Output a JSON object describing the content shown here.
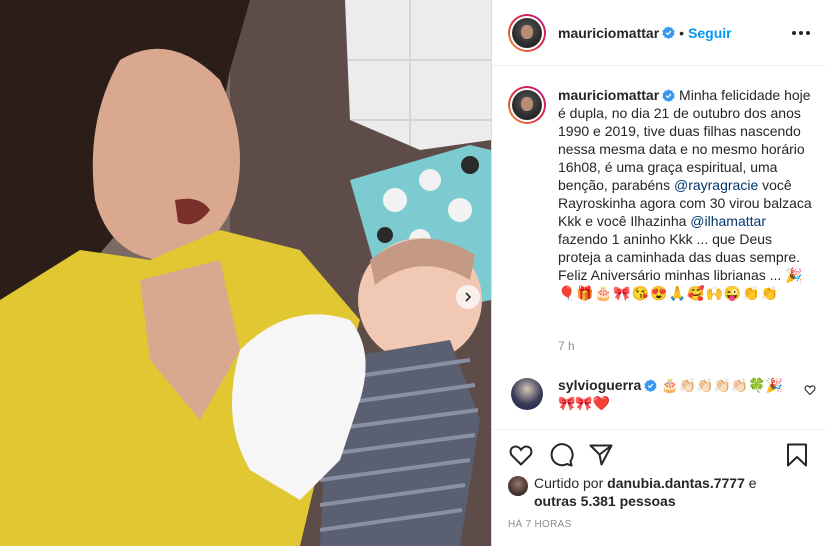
{
  "header": {
    "username": "mauriciomattar",
    "separator": "•",
    "follow_label": "Seguir",
    "more_icon": "more-horizontal-icon"
  },
  "caption": {
    "username": "mauriciomattar",
    "text_1": "Minha felicidade hoje é dupla, no dia 21 de outubro dos anos 1990 e 2019, tive duas filhas nascendo nessa mesma data e no mesmo horário 16h08, é uma graça espiritual, uma benção, parabéns ",
    "mention_1": "@rayragracie",
    "text_2": " você Rayroskinha agora com 30 virou balzaca Kkk e você Ilhazinha ",
    "mention_2": "@ilhamattar",
    "text_3": " fazendo 1 aninho Kkk ... que Deus proteja a caminhada das duas sempre. Feliz Aniversário minhas librianas ... ",
    "emojis": "🎉🎈🎁🎂🎀😘😍🙏🥰🙌😜👏👏",
    "time": "7 h"
  },
  "comment": {
    "username": "sylvioguerra",
    "text": " 🎂👏🏻👏🏻👏🏻👏🏻🍀🎉🎀🎀❤️"
  },
  "actions": {
    "like_icon": "heart-icon",
    "comment_icon": "comment-icon",
    "share_icon": "share-icon",
    "save_icon": "bookmark-icon"
  },
  "likes": {
    "prefix": "Curtido por ",
    "user": "danubia.dantas.7777",
    "middle": " e",
    "others": "outras 5.381 pessoas"
  },
  "timestamp": "HÁ 7 HORAS",
  "colors": {
    "accent": "#0095f6",
    "verified": "#3897f0",
    "mention": "#00376b",
    "muted": "#8e8e8e"
  }
}
